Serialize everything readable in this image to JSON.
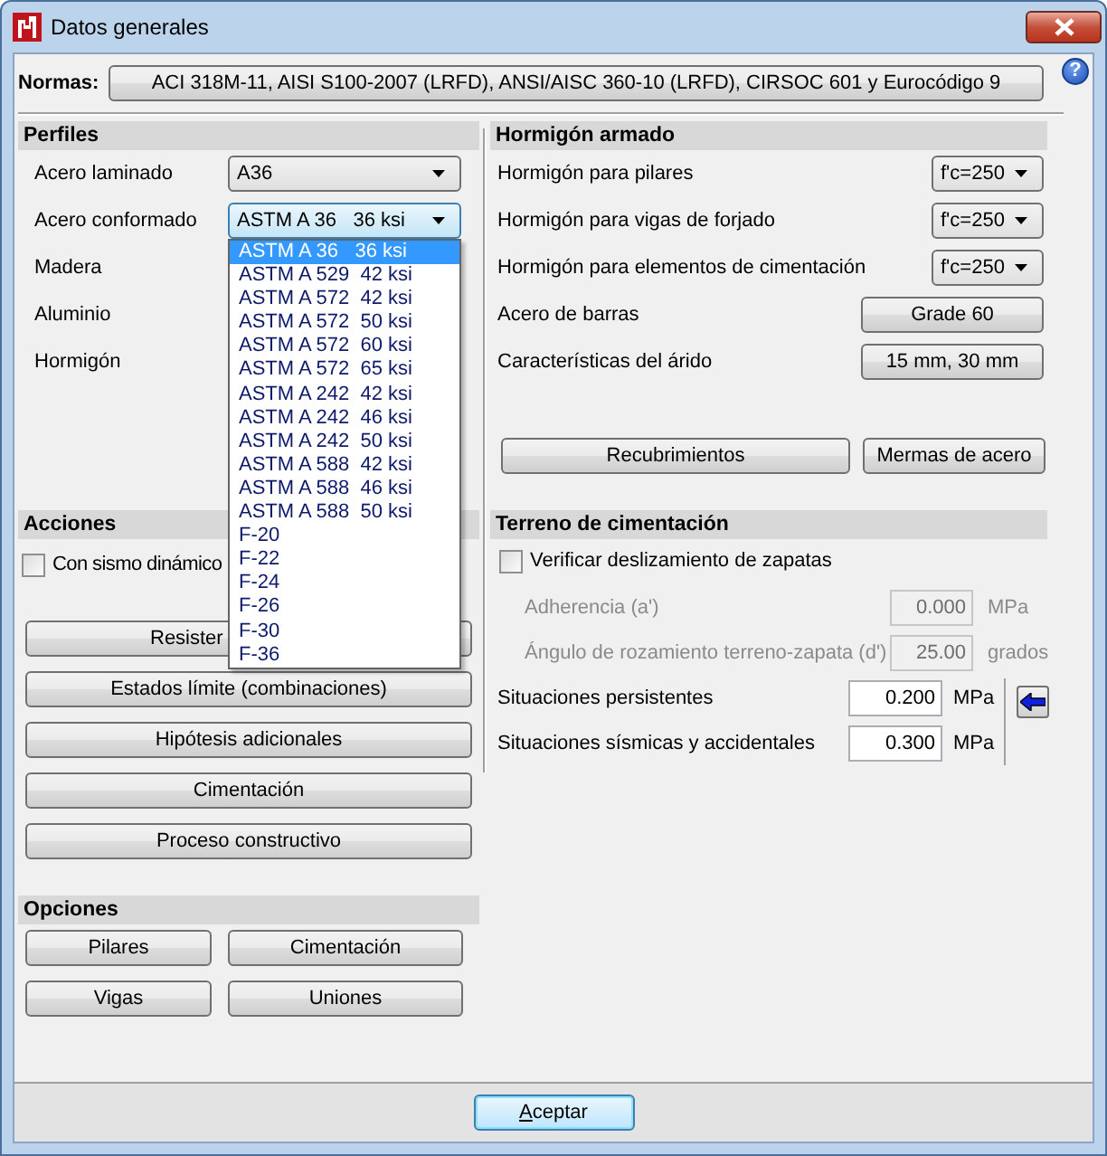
{
  "window": {
    "title": "Datos generales",
    "help_button": "?"
  },
  "normas": {
    "label": "Normas:",
    "value": "ACI 318M-11, AISI S100-2007 (LRFD), ANSI/AISC 360-10 (LRFD), CIRSOC 601 y Eurocódigo 9"
  },
  "perfiles": {
    "title": "Perfiles",
    "rows": [
      {
        "label": "Acero laminado",
        "value": "A36",
        "expanded": false
      },
      {
        "label": "Acero conformado",
        "value": "ASTM A 36   36 ksi",
        "expanded": true,
        "options": [
          {
            "label": "ASTM A 36   36 ksi",
            "selected": true
          },
          {
            "label": "ASTM A 529  42 ksi",
            "selected": false
          },
          {
            "label": "ASTM A 572  42 ksi",
            "selected": false
          },
          {
            "label": "ASTM A 572  50 ksi",
            "selected": false
          },
          {
            "label": "ASTM A 572  60 ksi",
            "selected": false
          },
          {
            "label": "ASTM A 572  65 ksi",
            "selected": false
          },
          {
            "label": "ASTM A 242  42 ksi",
            "selected": false
          },
          {
            "label": "ASTM A 242  46 ksi",
            "selected": false
          },
          {
            "label": "ASTM A 242  50 ksi",
            "selected": false
          },
          {
            "label": "ASTM A 588  42 ksi",
            "selected": false
          },
          {
            "label": "ASTM A 588  46 ksi",
            "selected": false
          },
          {
            "label": "ASTM A 588  50 ksi",
            "selected": false
          },
          {
            "label": "F-20",
            "selected": false
          },
          {
            "label": "F-22",
            "selected": false
          },
          {
            "label": "F-24",
            "selected": false
          },
          {
            "label": "F-26",
            "selected": false
          },
          {
            "label": "F-30",
            "selected": false
          },
          {
            "label": "F-36",
            "selected": false
          }
        ]
      },
      {
        "label": "Madera"
      },
      {
        "label": "Aluminio"
      },
      {
        "label": "Hormigón"
      }
    ]
  },
  "acciones": {
    "title": "Acciones",
    "checkbox": {
      "label": "Con sismo dinámico",
      "checked": false
    },
    "buttons": [
      {
        "label": "Resister",
        "covered": true
      },
      {
        "label": "Estados límite (combinaciones)",
        "covered": false
      },
      {
        "label": "Hipótesis adicionales",
        "covered": false
      },
      {
        "label": "Cimentación",
        "covered": false
      },
      {
        "label": "Proceso constructivo",
        "covered": false
      }
    ]
  },
  "opciones": {
    "title": "Opciones",
    "buttons": [
      "Pilares",
      "Cimentación",
      "Vigas",
      "Uniones"
    ]
  },
  "hormigon_armado": {
    "title": "Hormigón armado",
    "rows": [
      {
        "kind": "select",
        "label": "Hormigón para pilares",
        "value": "f'c=250"
      },
      {
        "kind": "select",
        "label": "Hormigón para vigas de forjado",
        "value": "f'c=250"
      },
      {
        "kind": "select",
        "label": "Hormigón para elementos de cimentación",
        "value": "f'c=250"
      },
      {
        "kind": "button",
        "label": "Acero de barras",
        "value": "Grade 60"
      },
      {
        "kind": "button",
        "label": "Características del árido",
        "value": "15 mm, 30 mm"
      }
    ],
    "buttons": [
      "Recubrimientos",
      "Mermas de acero"
    ]
  },
  "terreno": {
    "title": "Terreno de cimentación",
    "checkbox": {
      "label": "Verificar deslizamiento de zapatas",
      "checked": false
    },
    "fields": [
      {
        "label": "Adherencia (a')",
        "value": "0.000",
        "unit": "MPa",
        "disabled": true
      },
      {
        "label": "Ángulo de rozamiento terreno-zapata (d')",
        "value": "25.00",
        "unit": "grados",
        "disabled": true
      },
      {
        "label": "Situaciones persistentes",
        "value": "0.200",
        "unit": "MPa",
        "disabled": false
      },
      {
        "label": "Situaciones sísmicas y accidentales",
        "value": "0.300",
        "unit": "MPa",
        "disabled": false
      }
    ]
  },
  "footer": {
    "button": "Aceptar"
  }
}
